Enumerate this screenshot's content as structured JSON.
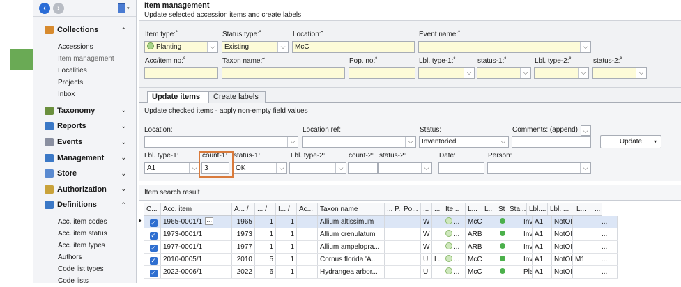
{
  "sidebar": {
    "sections": [
      {
        "label": "Collections",
        "chev": "⌃",
        "icon": "collections-icon",
        "color": "#d78a2e",
        "items": [
          "Accessions",
          "Item management",
          "Localities",
          "Projects",
          "Inbox"
        ]
      },
      {
        "label": "Taxonomy",
        "chev": "⌄",
        "icon": "taxonomy-icon",
        "color": "#6a8f3d",
        "items": []
      },
      {
        "label": "Reports",
        "chev": "⌄",
        "icon": "reports-icon",
        "color": "#3b78c6",
        "items": []
      },
      {
        "label": "Events",
        "chev": "⌄",
        "icon": "events-icon",
        "color": "#8a8fa0",
        "items": []
      },
      {
        "label": "Management",
        "chev": "⌄",
        "icon": "management-icon",
        "color": "#3b78c6",
        "items": []
      },
      {
        "label": "Store",
        "chev": "⌄",
        "icon": "store-icon",
        "color": "#5a8ad0",
        "items": []
      },
      {
        "label": "Authorization",
        "chev": "⌄",
        "icon": "authorization-icon",
        "color": "#c9a23a",
        "items": []
      },
      {
        "label": "Definitions",
        "chev": "⌃",
        "icon": "definitions-icon",
        "color": "#3b78c6",
        "items": [
          "Acc. item codes",
          "Acc. item status",
          "Acc. item types",
          "Authors",
          "Code list types",
          "Code lists"
        ]
      }
    ],
    "active_item": "Item management"
  },
  "header": {
    "title": "Item management",
    "subtitle": "Update selected accession items and create labels"
  },
  "filter": {
    "item_type_label": "Item type:˚",
    "item_type_value": "Planting",
    "status_type_label": "Status type:˚",
    "status_type_value": "Existing",
    "location_label": "Location:˜",
    "location_value": "McC",
    "event_name_label": "Event name:˚",
    "event_name_value": "",
    "acc_item_no_label": "Acc/item no:˚",
    "taxon_name_label": "Taxon name:˜",
    "pop_no_label": "Pop. no:˚",
    "lbl_type1_label": "Lbl. type-1:˚",
    "status1_label": "status-1:˚",
    "lbl_type2_label": "Lbl. type-2:˚",
    "status2_label": "status-2:˚"
  },
  "tabs": [
    "Update items",
    "Create labels"
  ],
  "update": {
    "note": "Update checked items - apply non-empty field values",
    "location_label": "Location:",
    "location_ref_label": "Location ref:",
    "status_label": "Status:",
    "status_value": "Inventoried",
    "comments_label": "Comments: (append)",
    "update_button": "Update",
    "lbl_type1_label": "Lbl. type-1:",
    "lbl_type1_value": "A1",
    "count1_label": "count-1:",
    "count1_value": "3",
    "status1_label": "status-1:",
    "status1_value": "OK",
    "lbl_type2_label": "Lbl. type-2:",
    "count2_label": "count-2:",
    "status2_label": "status-2:",
    "date_label": "Date:",
    "person_label": "Person:"
  },
  "grid": {
    "title": "Item search result",
    "columns": [
      "C...",
      "Acc. item",
      "A... /",
      "... /",
      "I... /",
      "Ac...",
      "Taxon name",
      "... P...",
      "Po...",
      "...",
      "...",
      "Ite...",
      "L...",
      "L...",
      "St",
      "Sta...",
      "Lbl....",
      "Lbl. ...",
      "L...",
      "..."
    ],
    "rows": [
      [
        "1965-0001/1",
        "1965",
        "1",
        "1",
        "",
        "Allium altissimum",
        "",
        "",
        "W",
        "",
        "...",
        "McC",
        "",
        "Inv...",
        "A1",
        "NotOK",
        "",
        "..."
      ],
      [
        "1973-0001/1",
        "1973",
        "1",
        "1",
        "",
        "Allium crenulatum",
        "",
        "",
        "W",
        "",
        "...",
        "ARB",
        "",
        "Inv...",
        "A1",
        "NotOK",
        "",
        "..."
      ],
      [
        "1977-0001/1",
        "1977",
        "1",
        "1",
        "",
        "Allium ampelopra...",
        "",
        "",
        "W",
        "",
        "...",
        "ARB",
        "",
        "Inv...",
        "A1",
        "NotOK",
        "",
        "..."
      ],
      [
        "2010-0005/1",
        "2010",
        "5",
        "1",
        "",
        "Cornus florida 'A...",
        "",
        "",
        "U",
        "L...",
        "...",
        "McC",
        "",
        "Inv...",
        "A1",
        "NotOK",
        "M1",
        "..."
      ],
      [
        "2022-0006/1",
        "2022",
        "6",
        "1",
        "",
        "Hydrangea arbor...",
        "",
        "",
        "U",
        "",
        "...",
        "McC",
        "",
        "Pla...",
        "A1",
        "NotOK",
        "",
        "..."
      ]
    ]
  }
}
